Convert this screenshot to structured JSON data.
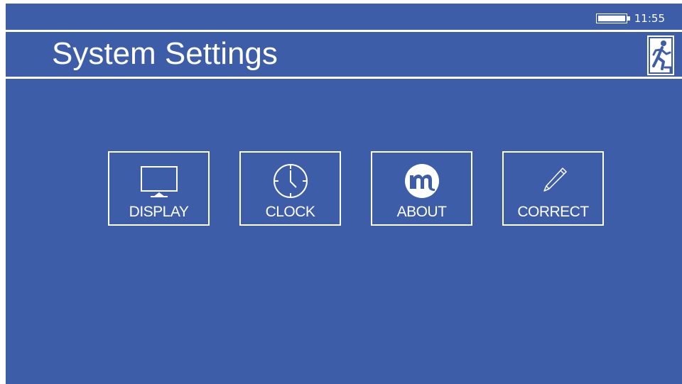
{
  "header": {
    "title": "System Settings",
    "time": "11:55",
    "battery_level": 1.0,
    "exit_icon": "exit-icon"
  },
  "tiles": [
    {
      "label": "DISPLAY",
      "icon": "monitor-icon"
    },
    {
      "label": "CLOCK",
      "icon": "clock-icon"
    },
    {
      "label": "ABOUT",
      "icon": "logo-icon"
    },
    {
      "label": "CORRECT",
      "icon": "pencil-icon"
    }
  ],
  "colors": {
    "background": "#3d5da8",
    "foreground": "#ffffff"
  }
}
